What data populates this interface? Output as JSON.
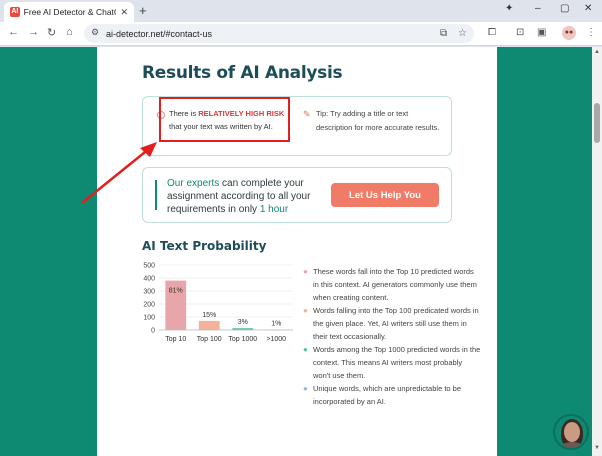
{
  "browser": {
    "tab_title": "Free AI Detector & ChatGPT",
    "favicon_text": "AI",
    "url": "ai-detector.net/#contact-us",
    "profile_initials": "●●"
  },
  "results": {
    "heading": "Results of AI Analysis",
    "risk_prefix": "There is",
    "risk_level": "RELATIVELY HIGH RISK",
    "risk_suffix": "that your text was written by AI.",
    "tip": "Tip: Try adding a title or text description for more accurate results."
  },
  "help": {
    "text_link": "Our experts",
    "text_body": "can complete your assignment according to all your requirements in only",
    "text_time": "1 hour",
    "button_label": "Let Us Help You"
  },
  "probability": {
    "heading": "AI Text Probability"
  },
  "chart_data": {
    "type": "bar",
    "categories": [
      "Top 10",
      "Top 100",
      "Top 1000",
      ">1000"
    ],
    "values": [
      380,
      70,
      14,
      4
    ],
    "data_labels": [
      "81%",
      "15%",
      "3%",
      "1%"
    ],
    "colors": [
      "#e8a6ab",
      "#f3b29a",
      "#5cc0a8",
      "#bcd6f0"
    ],
    "yticks": [
      0,
      100,
      200,
      300,
      400,
      500
    ],
    "ylim": [
      0,
      500
    ],
    "grid": true
  },
  "legend": [
    {
      "color": "#e8a6ab",
      "text": "These words fall into the Top 10 predicted words in this context. AI generators commonly use them when creating content."
    },
    {
      "color": "#f3b29a",
      "text": "Words falling into the Top 100 predicated words in the given place. Yet, AI writers still use them in their text occasionally."
    },
    {
      "color": "#5cc0a8",
      "text": "Words among the Top 1000 predicted words in the context. This means AI writers most probably won't use them."
    },
    {
      "color": "#8fb8e6",
      "text": "Unique words, which are unpredictable to be incorporated by an AI."
    }
  ]
}
